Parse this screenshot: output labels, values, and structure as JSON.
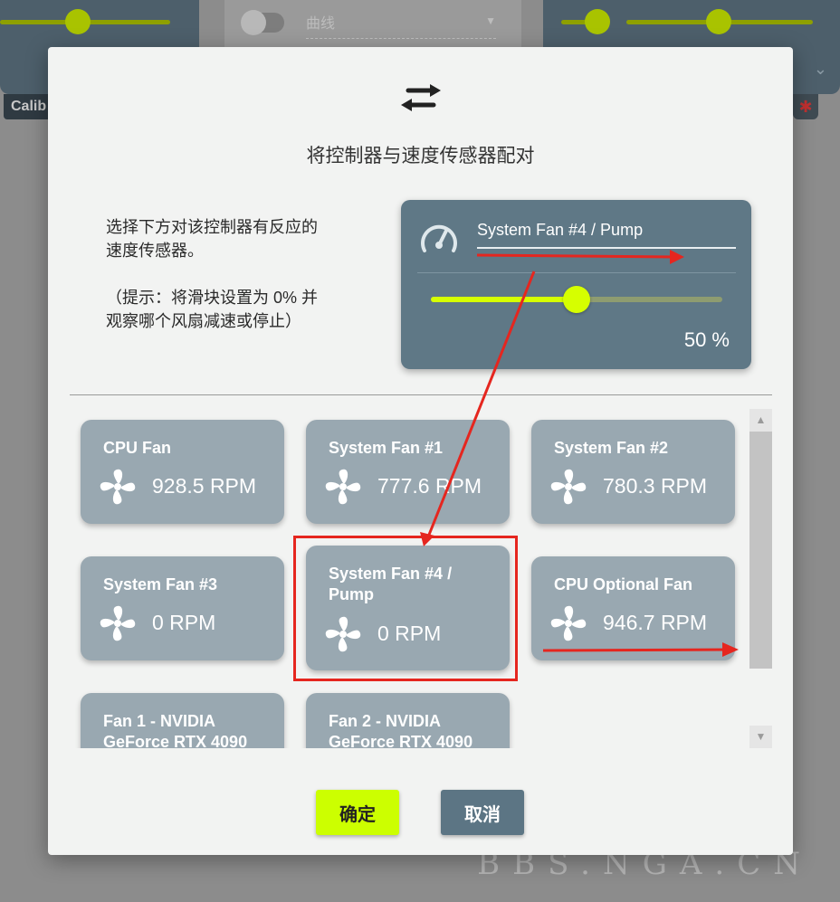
{
  "background": {
    "left_chip_label": "Calib",
    "mid_select_value": "曲线"
  },
  "dialog": {
    "title": "将控制器与速度传感器配对",
    "instructions": {
      "line1": "选择下方对该控制器有反应的",
      "line2": "速度传感器。",
      "line3": "（提示：将滑块设置为 0% 并",
      "line4": "观察哪个风扇减速或停止）"
    },
    "controller": {
      "name": "System Fan #4 / Pump",
      "percent_text": "50 %",
      "level": 0.5
    },
    "sensors": [
      {
        "name": "CPU Fan",
        "rpm": "928.5 RPM"
      },
      {
        "name": "System Fan #1",
        "rpm": "777.6 RPM"
      },
      {
        "name": "System Fan #2",
        "rpm": "780.3 RPM"
      },
      {
        "name": "System Fan #3",
        "rpm": "0 RPM"
      },
      {
        "name": "System Fan #4 / Pump",
        "rpm": "0 RPM"
      },
      {
        "name": "CPU Optional Fan",
        "rpm": "946.7 RPM"
      },
      {
        "name": "Fan 1 - NVIDIA GeForce RTX 4090",
        "rpm": ""
      },
      {
        "name": "Fan 2 - NVIDIA GeForce RTX 4090",
        "rpm": ""
      }
    ],
    "buttons": {
      "ok": "确定",
      "cancel": "取消"
    }
  },
  "watermark": "BBS.NGA.CN",
  "colors": {
    "accent": "#ccff00",
    "card": "#99a8b1",
    "controller_card": "#5f7886",
    "annotation": "#e5261f"
  },
  "icons": [
    "swap-arrows-icon",
    "gauge-icon",
    "fan-icon",
    "scroll-up-icon",
    "scroll-down-icon"
  ]
}
